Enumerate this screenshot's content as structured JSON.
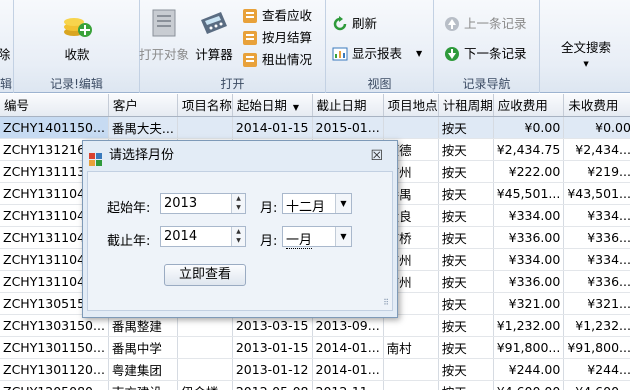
{
  "ribbon": {
    "partial_left_button": "除",
    "partial_left_group": "辑",
    "collect": "收款",
    "group_record_edit": "记录!编辑",
    "open_object": "打开对象",
    "calculator": "计算器",
    "view_receivable": "查看应收",
    "monthly_settle": "按月结算",
    "rent_out": "租出情况",
    "group_open": "打开",
    "refresh": "刷新",
    "show_report": "显示报表",
    "group_view": "视图",
    "prev_record": "上一条记录",
    "next_record": "下一条记录",
    "group_nav": "记录导航",
    "fulltext_search": "全文搜索"
  },
  "grid": {
    "headers": [
      "编号",
      "客户",
      "项目名称",
      "起始日期",
      "截止日期",
      "项目地点",
      "计租周期",
      "应收费用",
      "未收费用"
    ],
    "rows": [
      [
        "ZCHY1401150...",
        "番禺大夫...",
        "",
        "2014-01-15",
        "2015-01...",
        "",
        "按天",
        "¥0.00",
        "¥0.00"
      ],
      [
        "ZCHY1312160...",
        "",
        "",
        "",
        "",
        "顺德",
        "按天",
        "¥2,434.75",
        "¥2,434..."
      ],
      [
        "ZCHY1311130...",
        "",
        "",
        "",
        "",
        "广州",
        "按天",
        "¥222.00",
        "¥219..."
      ],
      [
        "ZCHY1311040...",
        "",
        "",
        "",
        "",
        "番禺",
        "按天",
        "¥45,501...",
        "¥43,501..."
      ],
      [
        "ZCHY1311040...",
        "",
        "",
        "",
        "",
        "大良",
        "按天",
        "¥334.00",
        "¥334..."
      ],
      [
        "ZCHY1311040...",
        "",
        "",
        "",
        "",
        "市桥",
        "按天",
        "¥336.00",
        "¥336..."
      ],
      [
        "ZCHY1311040...",
        "",
        "",
        "",
        "",
        "广州",
        "按天",
        "¥334.00",
        "¥334..."
      ],
      [
        "ZCHY1311040...",
        "",
        "",
        "",
        "",
        "广州",
        "按天",
        "¥336.00",
        "¥336..."
      ],
      [
        "ZCHY1305150...",
        "",
        "",
        "",
        "",
        "",
        "按天",
        "¥321.00",
        "¥321..."
      ],
      [
        "ZCHY1303150...",
        "番禺整建",
        "",
        "2013-03-15",
        "2013-09...",
        "",
        "按天",
        "¥1,232.00",
        "¥1,232..."
      ],
      [
        "ZCHY1301150...",
        "番禺中学",
        "",
        "2013-01-15",
        "2014-01...",
        "南村",
        "按天",
        "¥91,800...",
        "¥91,800..."
      ],
      [
        "ZCHY1301120...",
        "粤建集团",
        "",
        "2013-01-12",
        "2014-01...",
        "",
        "按天",
        "¥244.00",
        "¥244..."
      ],
      [
        "ZCHY1205080...",
        "南方建设",
        "伊金楼",
        "2012-05-08",
        "2012-11...",
        "",
        "按天",
        "¥4,600.00",
        "¥4,600..."
      ]
    ]
  },
  "dialog": {
    "title": "请选择月份",
    "start_year_label": "起始年:",
    "start_year": "2013",
    "start_month_label": "月:",
    "start_month": "十二月",
    "end_year_label": "截止年:",
    "end_year": "2014",
    "end_month_label": "月:",
    "end_month": "一月",
    "query_button": "立即查看",
    "close": "☒"
  }
}
